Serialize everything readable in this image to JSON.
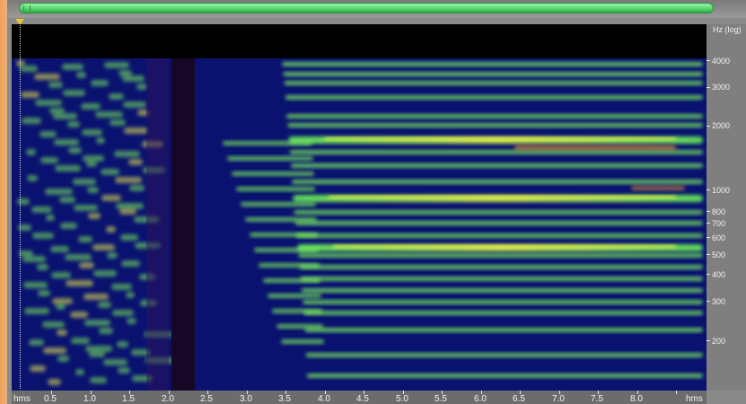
{
  "title": "Hz (log)",
  "freq_labels": [
    "4000",
    "3000",
    "2000",
    "1000",
    "800",
    "700",
    "600",
    "500",
    "400",
    "300",
    "200"
  ],
  "time_labels": [
    "0.5",
    "1.0",
    "1.5",
    "2.0",
    "2.5",
    "3.0",
    "3.5",
    "4.0",
    "4.5",
    "5.0",
    "5.5",
    "6.0",
    "6.5",
    "7.0",
    "7.5",
    "8.0"
  ],
  "axis_unit": "hms",
  "colors": {
    "background": "#070d6c",
    "band_green": "#7cf25a",
    "band_yellow": "#f1ef4a",
    "band_orange": "#f09a33",
    "gap_dark": "#17071e"
  }
}
